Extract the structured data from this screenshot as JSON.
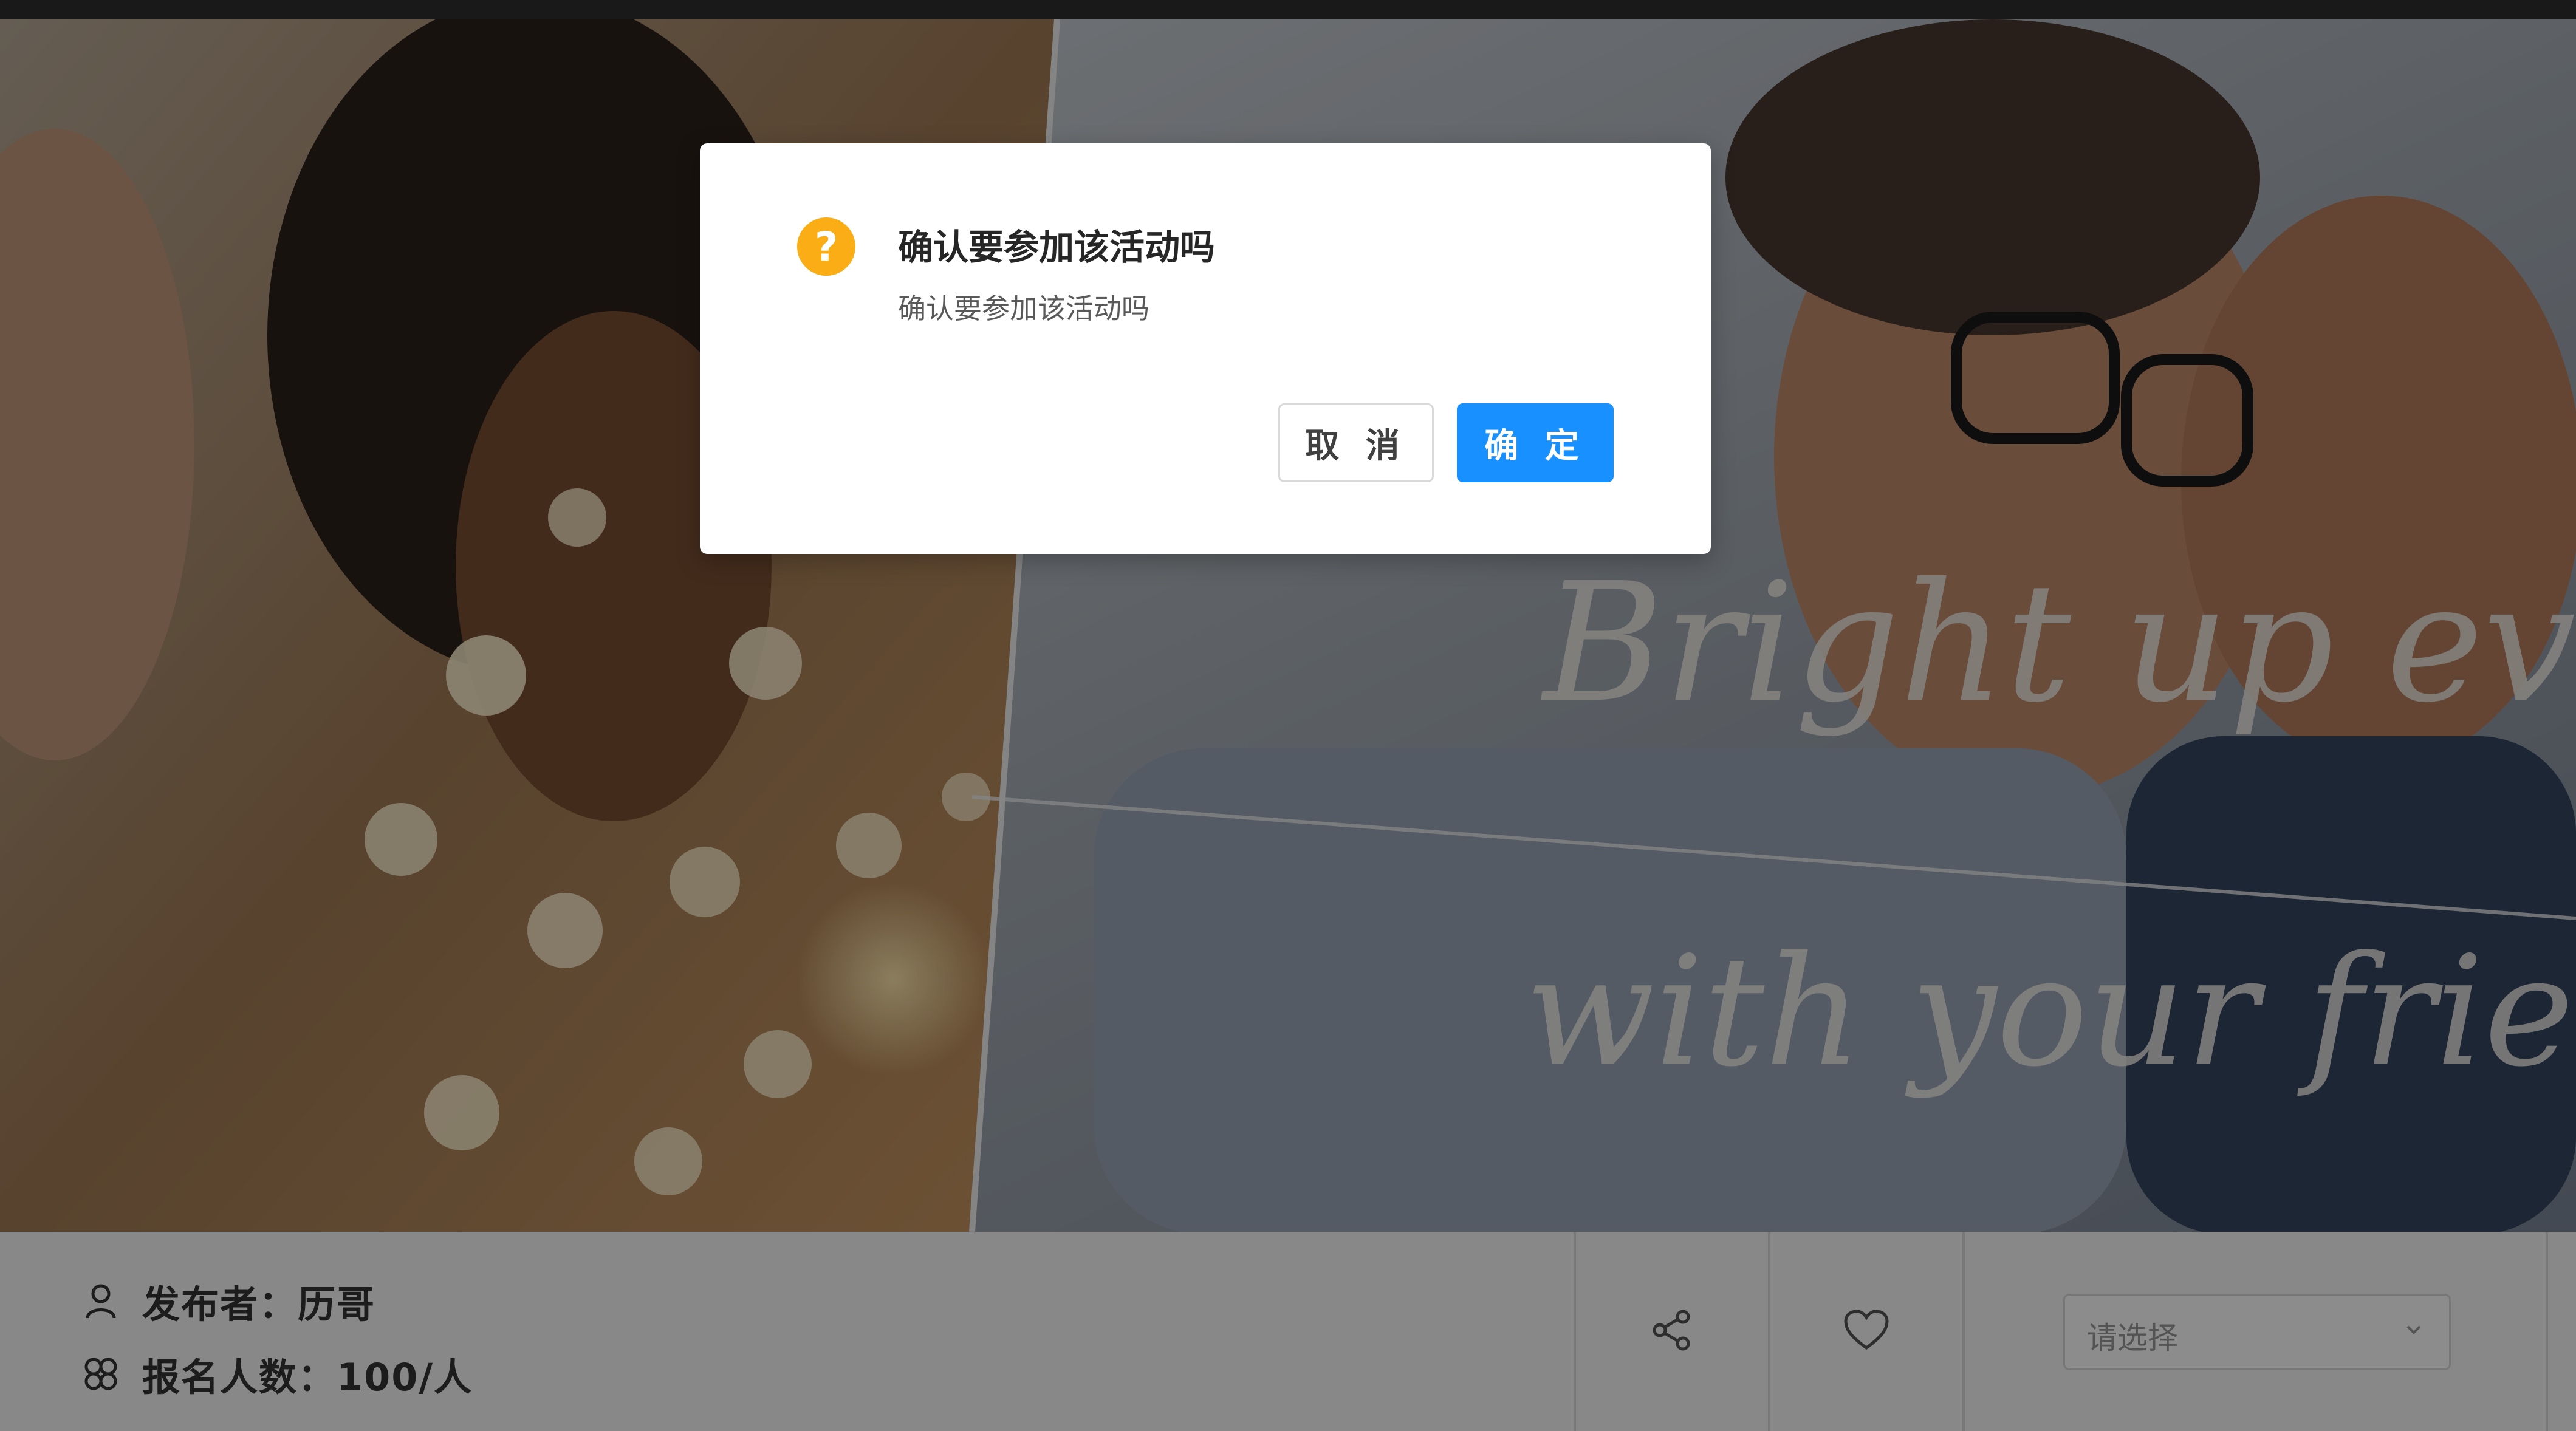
{
  "banner": {
    "tagline_line1": "Bright up every da",
    "tagline_line2": "with your friends"
  },
  "info": {
    "publisher": "发布者：历哥",
    "signups": "报名人数：100/人",
    "publisher_icon": "user-icon",
    "signups_icon": "group-icon"
  },
  "actions": {
    "share_icon": "share-icon",
    "favorite_icon": "heart-icon",
    "select_placeholder": "请选择"
  },
  "modal": {
    "title": "确认要参加该活动吗",
    "content": "确认要参加该活动吗",
    "cancel_label": "取 消",
    "ok_label": "确 定",
    "icon": "question-icon"
  },
  "colors": {
    "primary": "#1890ff",
    "warning": "#faad14"
  }
}
